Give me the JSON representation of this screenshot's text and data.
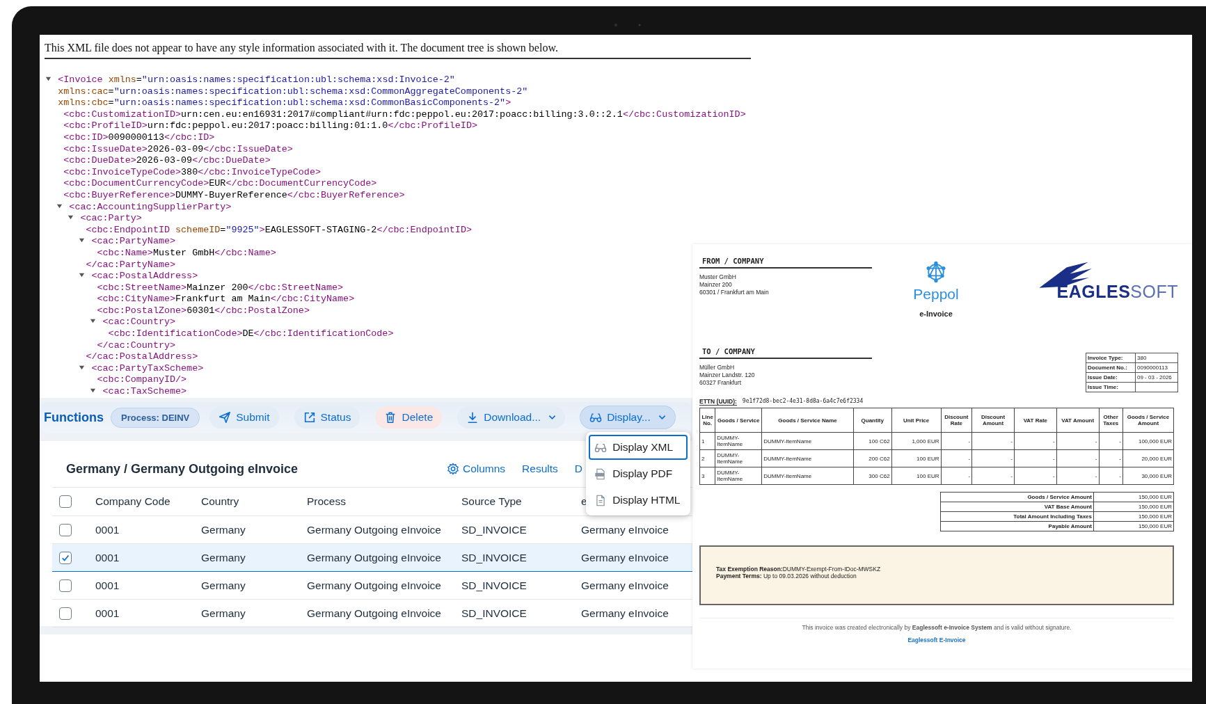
{
  "xml_viewer": {
    "notice": "This XML file does not appear to have any style information associated with it. The document tree is shown below.",
    "tree": [
      {
        "open": [
          "<Invoice xmlns=\"urn:oasis:names:specification:ubl:schema:xsd:Invoice-2\"",
          "xmlns:cac=\"urn:oasis:names:specification:ubl:schema:xsd:CommonAggregateComponents-2\"",
          "xmlns:cbc=\"urn:oasis:names:specification:ubl:schema:xsd:CommonBasicComponents-2\">"
        ],
        "expanded": true,
        "children": [
          {
            "text": "<cbc:CustomizationID>urn:cen.eu:en16931:2017#compliant#urn:fdc:peppol.eu:2017:poacc:billing:3.0::2.1</cbc:CustomizationID>"
          },
          {
            "text": "<cbc:ProfileID>urn:fdc:peppol.eu:2017:poacc:billing:01:1.0</cbc:ProfileID>"
          },
          {
            "text": "<cbc:ID>0090000113</cbc:ID>"
          },
          {
            "text": "<cbc:IssueDate>2026-03-09</cbc:IssueDate>"
          },
          {
            "text": "<cbc:DueDate>2026-03-09</cbc:DueDate>"
          },
          {
            "text": "<cbc:InvoiceTypeCode>380</cbc:InvoiceTypeCode>"
          },
          {
            "text": "<cbc:DocumentCurrencyCode>EUR</cbc:DocumentCurrencyCode>"
          },
          {
            "text": "<cbc:BuyerReference>DUMMY-BuyerReference</cbc:BuyerReference>"
          },
          {
            "open": [
              "<cac:AccountingSupplierParty>"
            ],
            "expanded": true,
            "children": [
              {
                "open": [
                  "<cac:Party>"
                ],
                "expanded": true,
                "children": [
                  {
                    "text": "<cbc:EndpointID schemeID=\"9925\">EAGLESSOFT-STAGING-2</cbc:EndpointID>"
                  },
                  {
                    "open": [
                      "<cac:PartyName>"
                    ],
                    "expanded": true,
                    "children": [
                      {
                        "text": "<cbc:Name>Muster GmbH</cbc:Name>"
                      }
                    ],
                    "close": "</cac:PartyName>"
                  },
                  {
                    "open": [
                      "<cac:PostalAddress>"
                    ],
                    "expanded": true,
                    "children": [
                      {
                        "text": "<cbc:StreetName>Mainzer 200</cbc:StreetName>"
                      },
                      {
                        "text": "<cbc:CityName>Frankfurt am Main</cbc:CityName>"
                      },
                      {
                        "text": "<cbc:PostalZone>60301</cbc:PostalZone>"
                      },
                      {
                        "open": [
                          "<cac:Country>"
                        ],
                        "expanded": true,
                        "children": [
                          {
                            "text": "<cbc:IdentificationCode>DE</cbc:IdentificationCode>"
                          }
                        ],
                        "close": "</cac:Country>"
                      }
                    ],
                    "close": "</cac:PostalAddress>"
                  },
                  {
                    "open": [
                      "<cac:PartyTaxScheme>"
                    ],
                    "expanded": true,
                    "children": [
                      {
                        "text": "<cbc:CompanyID/>"
                      },
                      {
                        "open": [
                          "<cac:TaxScheme>"
                        ],
                        "expanded": true
                      }
                    ]
                  }
                ]
              }
            ]
          }
        ]
      }
    ]
  },
  "functions_bar": {
    "title": "Functions",
    "process_badge": "Process: DEINV",
    "buttons": [
      {
        "label": "Submit",
        "kind": "default",
        "has_menu": false,
        "expanded": false
      },
      {
        "label": "Status",
        "kind": "default",
        "has_menu": false,
        "expanded": false
      },
      {
        "label": "Delete",
        "kind": "danger",
        "has_menu": false,
        "expanded": false
      },
      {
        "label": "Download...",
        "kind": "default",
        "has_menu": true,
        "expanded": false
      },
      {
        "label": "Display...",
        "kind": "default",
        "has_menu": true,
        "expanded": true,
        "menu": [
          {
            "label": "Display XML",
            "selected": true
          },
          {
            "label": "Display PDF",
            "selected": false
          },
          {
            "label": "Display HTML",
            "selected": false
          }
        ]
      }
    ]
  },
  "table_card": {
    "title": "Germany / Germany Outgoing eInvoice",
    "actions": [
      {
        "label": "Columns",
        "kind": "settings"
      },
      {
        "label": "Results",
        "kind": "text"
      },
      {
        "label": "D",
        "kind": "text"
      }
    ],
    "header_checked": false,
    "columns": [
      "Company Code",
      "Country",
      "Process",
      "Source Type",
      "e"
    ],
    "rows": [
      {
        "cells": [
          "0001",
          "Germany",
          "Germany Outgoing eInvoice",
          "SD_INVOICE",
          "Germany eInvoice"
        ],
        "selected": false
      },
      {
        "cells": [
          "0001",
          "Germany",
          "Germany Outgoing eInvoice",
          "SD_INVOICE",
          "Germany eInvoice"
        ],
        "selected": true
      },
      {
        "cells": [
          "0001",
          "Germany",
          "Germany Outgoing eInvoice",
          "SD_INVOICE",
          "Germany eInvoice"
        ],
        "selected": false
      },
      {
        "cells": [
          "0001",
          "Germany",
          "Germany Outgoing eInvoice",
          "SD_INVOICE",
          "Germany eInvoice"
        ],
        "selected": false
      }
    ]
  },
  "invoice": {
    "from": {
      "heading": "FROM / COMPANY",
      "lines": [
        "Muster GmbH",
        "Mainzer 200",
        "60301 / Frankfurt am Main"
      ]
    },
    "peppol_logo": {
      "name": "Peppol",
      "caption": "e-Invoice"
    },
    "eaglessoft_logo": {
      "wordmark": "**EAGLES**SOFT"
    },
    "to": {
      "heading": "TO / COMPANY",
      "lines": [
        "Müller GmbH",
        "Mainzer Landstr. 120",
        "60327 Frankfurt"
      ]
    },
    "info": [
      {
        "label": "Invoice Type:",
        "value": "380"
      },
      {
        "label": "Document No.:",
        "value": "0090000113"
      },
      {
        "label": "Issue Date:",
        "value": "09 - 03 - 2026"
      },
      {
        "label": "Issue Time:"
      }
    ],
    "ettn": {
      "label": "ETTN (UUID):",
      "value": "9e1f72d8-bec2-4e31-8d8a-6a4c7e6f2334"
    },
    "items": {
      "columns": [
        "Line No.",
        "Goods / Service",
        "Goods / Service Name",
        "Quantity",
        "Unit Price",
        "Discount Rate",
        "Discount Amount",
        "VAT Rate",
        "VAT Amount",
        "Other Taxes",
        "Goods / Service Amount"
      ],
      "rows": [
        [
          "1",
          "DUMMY-ItemName",
          "DUMMY-ItemName",
          "100 C62",
          "1,000 EUR",
          "-",
          "-",
          "-",
          "-",
          "-",
          "100,000 EUR"
        ],
        [
          "2",
          "DUMMY-ItemName",
          "DUMMY-ItemName",
          "200 C62",
          "100 EUR",
          "-",
          "-",
          "-",
          "-",
          "-",
          "20,000 EUR"
        ],
        [
          "3",
          "DUMMY-ItemName",
          "DUMMY-ItemName",
          "300 C62",
          "100 EUR",
          "-",
          "-",
          "-",
          "-",
          "-",
          "30,000 EUR"
        ]
      ]
    },
    "totals": [
      {
        "label": "Goods / Service Amount",
        "value": "150,000 EUR"
      },
      {
        "label": "VAT Base Amount",
        "value": "150,000 EUR"
      },
      {
        "label": "Total Amount Including Taxes",
        "value": "150,000 EUR"
      },
      {
        "label": "Payable Amount",
        "value": "150,000 EUR"
      }
    ],
    "notes": [
      "**Tax Exemption Reason:**DUMMY-Exempt-From-IDoc-MWSKZ",
      "**Payment Terms:** Up to 09.03.2026 without deduction"
    ],
    "footer": "This invoice was created electronically by **Eaglessoft e-Invoice System** and is valid without signature.",
    "footer_link": "Eaglessoft E-Invoice"
  }
}
